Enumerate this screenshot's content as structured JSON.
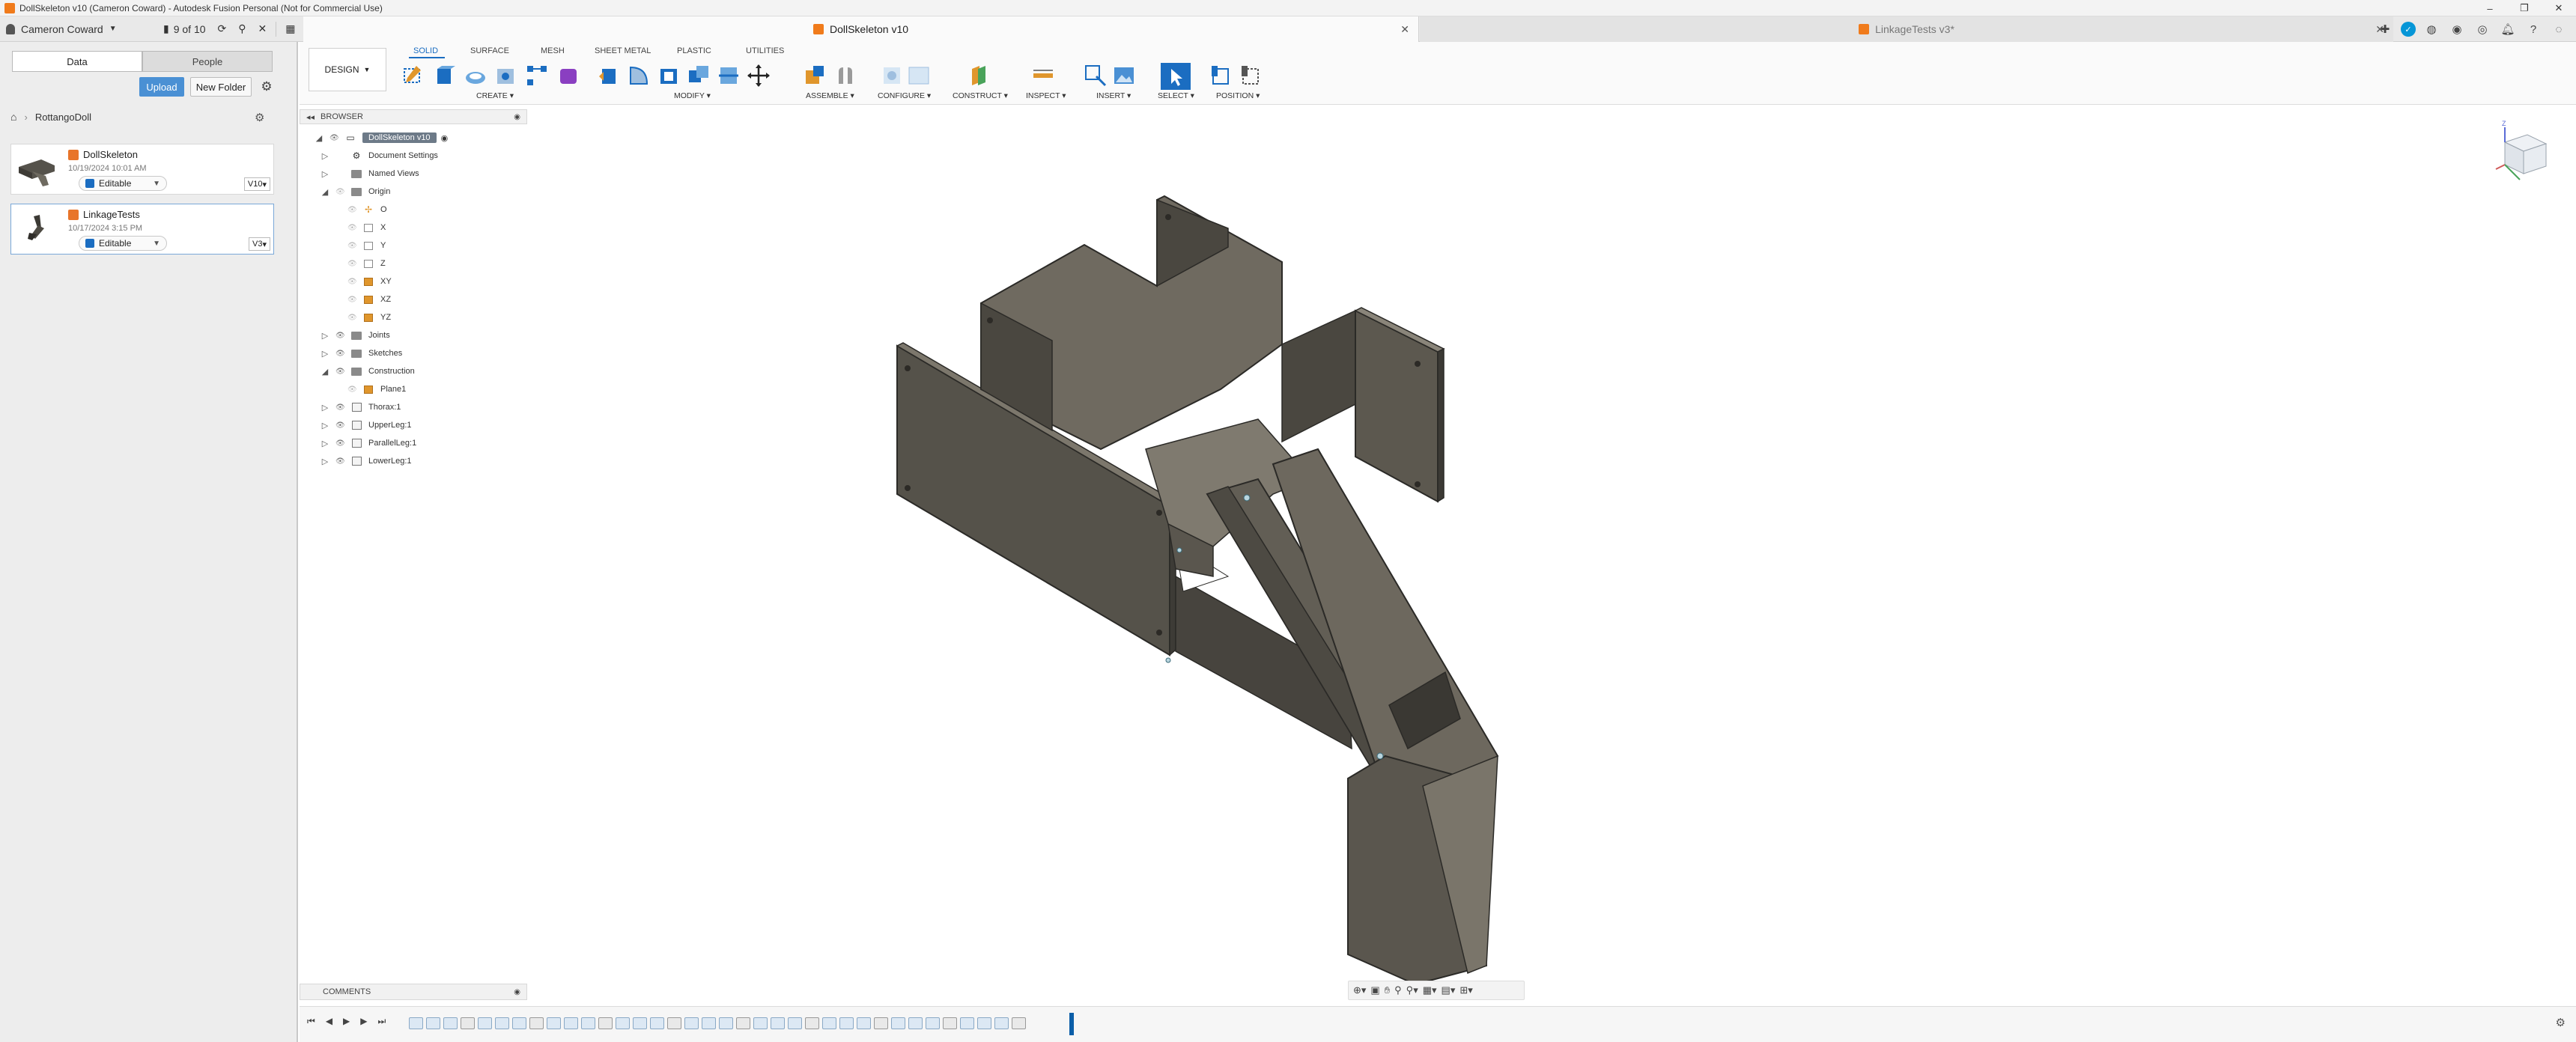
{
  "window": {
    "title": "DollSkeleton v10 (Cameron Coward) - Autodesk Fusion Personal (Not for Commercial Use)",
    "controls": [
      "–",
      "❐",
      "✕"
    ]
  },
  "appbar": {
    "user": "Cameron Coward",
    "jobs": "9 of 10",
    "tabs": [
      {
        "label": "DollSkeleton v10",
        "active": true
      },
      {
        "label": "LinkageTests v3*",
        "active": false
      }
    ]
  },
  "datapanel": {
    "tabs": [
      "Data",
      "People"
    ],
    "upload": "Upload",
    "new_folder": "New Folder",
    "breadcrumb": "RottangoDoll",
    "files": [
      {
        "name": "DollSkeleton",
        "date": "10/19/2024 10:01 AM",
        "status": "Editable",
        "version": "V10"
      },
      {
        "name": "LinkageTests",
        "date": "10/17/2024 3:15 PM",
        "status": "Editable",
        "version": "V3"
      }
    ]
  },
  "toolbar": {
    "workspace": "DESIGN",
    "tabs": [
      "SOLID",
      "SURFACE",
      "MESH",
      "SHEET METAL",
      "PLASTIC",
      "UTILITIES"
    ],
    "groups": [
      "CREATE",
      "MODIFY",
      "ASSEMBLE",
      "CONFIGURE",
      "CONSTRUCT",
      "INSPECT",
      "INSERT",
      "SELECT",
      "POSITION"
    ]
  },
  "browser": {
    "title": "BROWSER",
    "root": "DollSkeleton v10",
    "items": [
      {
        "label": "Document Settings",
        "level": 1,
        "tri": "▷",
        "eye": "",
        "icon": "gear-icon"
      },
      {
        "label": "Named Views",
        "level": 1,
        "tri": "▷",
        "eye": "",
        "icon": "folder-icon"
      },
      {
        "label": "Origin",
        "level": 1,
        "tri": "◢",
        "eye": "dim",
        "icon": "folder-icon"
      },
      {
        "label": "O",
        "level": 2,
        "tri": "",
        "eye": "dim",
        "icon": "origin-point-icon"
      },
      {
        "label": "X",
        "level": 2,
        "tri": "",
        "eye": "dim",
        "icon": "axis-icon"
      },
      {
        "label": "Y",
        "level": 2,
        "tri": "",
        "eye": "dim",
        "icon": "axis-icon"
      },
      {
        "label": "Z",
        "level": 2,
        "tri": "",
        "eye": "dim",
        "icon": "axis-icon"
      },
      {
        "label": "XY",
        "level": 2,
        "tri": "",
        "eye": "dim",
        "icon": "plane-icon"
      },
      {
        "label": "XZ",
        "level": 2,
        "tri": "",
        "eye": "dim",
        "icon": "plane-icon"
      },
      {
        "label": "YZ",
        "level": 2,
        "tri": "",
        "eye": "dim",
        "icon": "plane-icon"
      },
      {
        "label": "Joints",
        "level": 1,
        "tri": "▷",
        "eye": "on",
        "icon": "folder-icon"
      },
      {
        "label": "Sketches",
        "level": 1,
        "tri": "▷",
        "eye": "on",
        "icon": "folder-icon"
      },
      {
        "label": "Construction",
        "level": 1,
        "tri": "◢",
        "eye": "on",
        "icon": "folder-icon"
      },
      {
        "label": "Plane1",
        "level": 2,
        "tri": "",
        "eye": "dim",
        "icon": "plane-icon"
      },
      {
        "label": "Thorax:1",
        "level": 1,
        "tri": "▷",
        "eye": "on",
        "icon": "component-icon"
      },
      {
        "label": "UpperLeg:1",
        "level": 1,
        "tri": "▷",
        "eye": "on",
        "icon": "component-icon"
      },
      {
        "label": "ParallelLeg:1",
        "level": 1,
        "tri": "▷",
        "eye": "on",
        "icon": "component-icon"
      },
      {
        "label": "LowerLeg:1",
        "level": 1,
        "tri": "▷",
        "eye": "on",
        "icon": "component-icon"
      }
    ]
  },
  "comments": {
    "title": "COMMENTS"
  },
  "colors": {
    "accent": "#1b6dc1",
    "model_dark": "#4d4a43",
    "model_mid": "#6e6a60",
    "model_light": "#8a857a"
  }
}
